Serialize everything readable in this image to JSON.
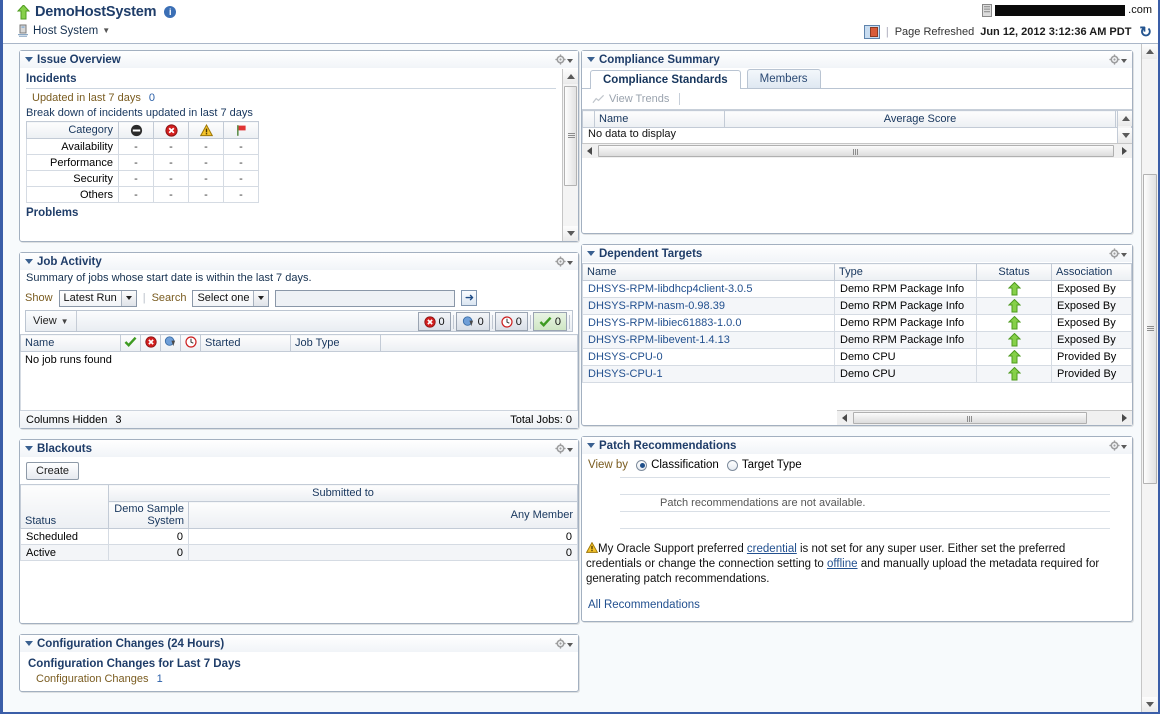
{
  "header": {
    "target_name": "DemoHostSystem",
    "target_type": "Host System",
    "info_glyph": "i",
    "host_redacted_suffix": ".com",
    "refreshed_label": "Page Refreshed",
    "refreshed_time": "Jun 12, 2012 3:12:36 AM PDT",
    "refresh_glyph": "↻"
  },
  "issue_overview": {
    "title": "Issue Overview",
    "incidents_heading": "Incidents",
    "updated_label": "Updated in last 7 days",
    "updated_value": "0",
    "breakdown_label": "Break down of incidents updated in last 7 days",
    "columns": [
      "Category",
      "blocked-icon",
      "critical-icon",
      "warning-icon",
      "flag-icon"
    ],
    "category_header": "Category",
    "rows": [
      {
        "category": "Availability",
        "values": [
          "-",
          "-",
          "-",
          "-"
        ]
      },
      {
        "category": "Performance",
        "values": [
          "-",
          "-",
          "-",
          "-"
        ]
      },
      {
        "category": "Security",
        "values": [
          "-",
          "-",
          "-",
          "-"
        ]
      },
      {
        "category": "Others",
        "values": [
          "-",
          "-",
          "-",
          "-"
        ]
      }
    ],
    "problems_heading": "Problems"
  },
  "job_activity": {
    "title": "Job Activity",
    "description": "Summary of jobs whose start date is within the last 7 days.",
    "show_label": "Show",
    "show_value": "Latest Run",
    "search_label": "Search",
    "search_select_value": "Select one",
    "search_input_value": "",
    "go_icon": "arrow-right-icon",
    "view_label": "View",
    "chips": [
      {
        "icon": "error-icon",
        "count": "0"
      },
      {
        "icon": "suspended-icon",
        "count": "0"
      },
      {
        "icon": "running-icon",
        "count": "0"
      },
      {
        "icon": "success-icon",
        "count": "0"
      }
    ],
    "columns": [
      "Name",
      "success-icon",
      "error-icon",
      "suspended-icon",
      "running-icon",
      "Started",
      "Job Type",
      ""
    ],
    "empty_text": "No job runs found",
    "columns_hidden_label": "Columns Hidden",
    "columns_hidden_value": "3",
    "total_jobs": "Total Jobs: 0"
  },
  "blackouts": {
    "title": "Blackouts",
    "create_label": "Create",
    "group_header": "Submitted to",
    "columns": [
      "Status",
      "Demo Sample System",
      "Any Member"
    ],
    "rows": [
      {
        "status": "Scheduled",
        "demo_sample_system": "0",
        "any_member": "0"
      },
      {
        "status": "Active",
        "demo_sample_system": "0",
        "any_member": "0"
      }
    ]
  },
  "configuration_changes": {
    "title": "Configuration Changes (24 Hours)",
    "subtitle": "Configuration Changes for Last 7 Days",
    "metric_label": "Configuration Changes",
    "metric_value": "1"
  },
  "compliance_summary": {
    "title": "Compliance Summary",
    "tabs": [
      {
        "label": "Compliance Standards",
        "active": true
      },
      {
        "label": "Members",
        "active": false
      }
    ],
    "toolbar_button": "View Trends",
    "columns": [
      "Name",
      "Average Score"
    ],
    "empty_text": "No data to display"
  },
  "dependent_targets": {
    "title": "Dependent Targets",
    "columns": [
      "Name",
      "Type",
      "Status",
      "Association"
    ],
    "rows": [
      {
        "name": "DHSYS-RPM-libdhcp4client-3.0.5",
        "type": "Demo RPM Package Info",
        "status": "up-icon",
        "association": "Exposed By"
      },
      {
        "name": "DHSYS-RPM-nasm-0.98.39",
        "type": "Demo RPM Package Info",
        "status": "up-icon",
        "association": "Exposed By"
      },
      {
        "name": "DHSYS-RPM-libiec61883-1.0.0",
        "type": "Demo RPM Package Info",
        "status": "up-icon",
        "association": "Exposed By"
      },
      {
        "name": "DHSYS-RPM-libevent-1.4.13",
        "type": "Demo RPM Package Info",
        "status": "up-icon",
        "association": "Exposed By"
      },
      {
        "name": "DHSYS-CPU-0",
        "type": "Demo CPU",
        "status": "up-icon",
        "association": "Provided By"
      },
      {
        "name": "DHSYS-CPU-1",
        "type": "Demo CPU",
        "status": "up-icon",
        "association": "Provided By"
      }
    ]
  },
  "patch_recommendations": {
    "title": "Patch Recommendations",
    "view_by_label": "View by",
    "options": [
      {
        "label": "Classification",
        "selected": true
      },
      {
        "label": "Target Type",
        "selected": false
      }
    ],
    "empty_text": "Patch recommendations are not available.",
    "warning_part1": "My Oracle Support preferred ",
    "warning_link1": "credential",
    "warning_part2": " is not set for any super user. Either set the preferred credentials or change the connection setting to ",
    "warning_link2": "offline",
    "warning_part3": " and manually upload the metadata required for generating patch recommendations.",
    "all_recommendations": "All Recommendations"
  },
  "colors": {
    "accent_blue": "#1f3d69",
    "link_blue": "#22508f",
    "status_up_green": "#5fbb31",
    "critical_red": "#cc2222",
    "warning_amber": "#f0b323",
    "panel_border": "#a3b0c0",
    "window_border": "#3b5ea8"
  }
}
